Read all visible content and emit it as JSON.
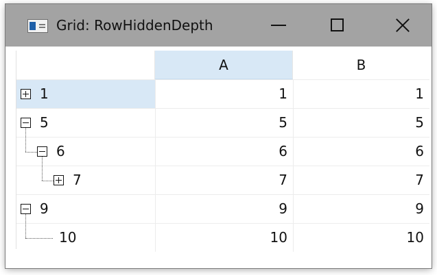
{
  "window": {
    "title": "Grid: RowHiddenDepth"
  },
  "grid": {
    "columns": [
      "A",
      "B"
    ],
    "rows": [
      {
        "label": "1",
        "expander": "plus",
        "level": 0,
        "a": "1",
        "b": "1",
        "selected": true
      },
      {
        "label": "5",
        "expander": "minus",
        "level": 0,
        "a": "5",
        "b": "5"
      },
      {
        "label": "6",
        "expander": "minus",
        "level": 1,
        "a": "6",
        "b": "6"
      },
      {
        "label": "7",
        "expander": "plus",
        "level": 2,
        "a": "7",
        "b": "7"
      },
      {
        "label": "9",
        "expander": "minus",
        "level": 0,
        "a": "9",
        "b": "9"
      },
      {
        "label": "10",
        "expander": "none",
        "level": 1,
        "a": "10",
        "b": "10"
      }
    ]
  },
  "colors": {
    "titlebar": "#a3a3a3",
    "selection": "#d8e8f6"
  }
}
